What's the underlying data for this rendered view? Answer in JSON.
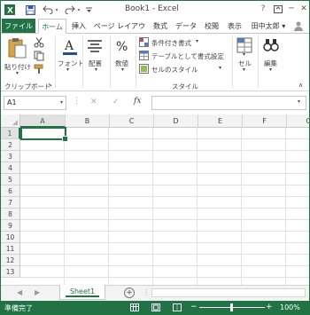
{
  "title_bar": {
    "title": "Book1 - Excel",
    "help": "?",
    "minimize": "─",
    "close": "✕"
  },
  "tabs": [
    {
      "label": "ファイル"
    },
    {
      "label": "ホーム"
    },
    {
      "label": "挿入"
    },
    {
      "label": "ページ レイアウト"
    },
    {
      "label": "数式"
    },
    {
      "label": "データ"
    },
    {
      "label": "校閲"
    },
    {
      "label": "表示"
    },
    {
      "label": "田中太郎 ▾"
    }
  ],
  "ribbon": {
    "paste": "貼り付け",
    "clipboard_group": "クリップボード",
    "font": "フォント",
    "alignment": "配置",
    "number": "数値",
    "conditional_formatting": "条件付き書式",
    "format_as_table": "テーブルとして書式設定",
    "cell_styles": "セルのスタイル",
    "styles_group": "スタイル",
    "cells": "セル",
    "editing": "編集"
  },
  "formula_bar": {
    "name_box": "A1",
    "fx": "fx",
    "cancel": "✕",
    "enter": "✓"
  },
  "grid": {
    "columns": [
      "A",
      "B",
      "C",
      "D",
      "E",
      "F",
      "G"
    ],
    "rows": [
      "1",
      "2",
      "3",
      "4",
      "5",
      "6",
      "7",
      "8",
      "9",
      "10",
      "11",
      "12",
      "13"
    ],
    "active_cell": "A1"
  },
  "sheets": {
    "tabs": [
      "Sheet1"
    ],
    "add": "+"
  },
  "status_bar": {
    "ready": "準備完了",
    "zoom": "100%",
    "minus": "−",
    "plus": "+"
  },
  "colors": {
    "accent": "#217346"
  }
}
